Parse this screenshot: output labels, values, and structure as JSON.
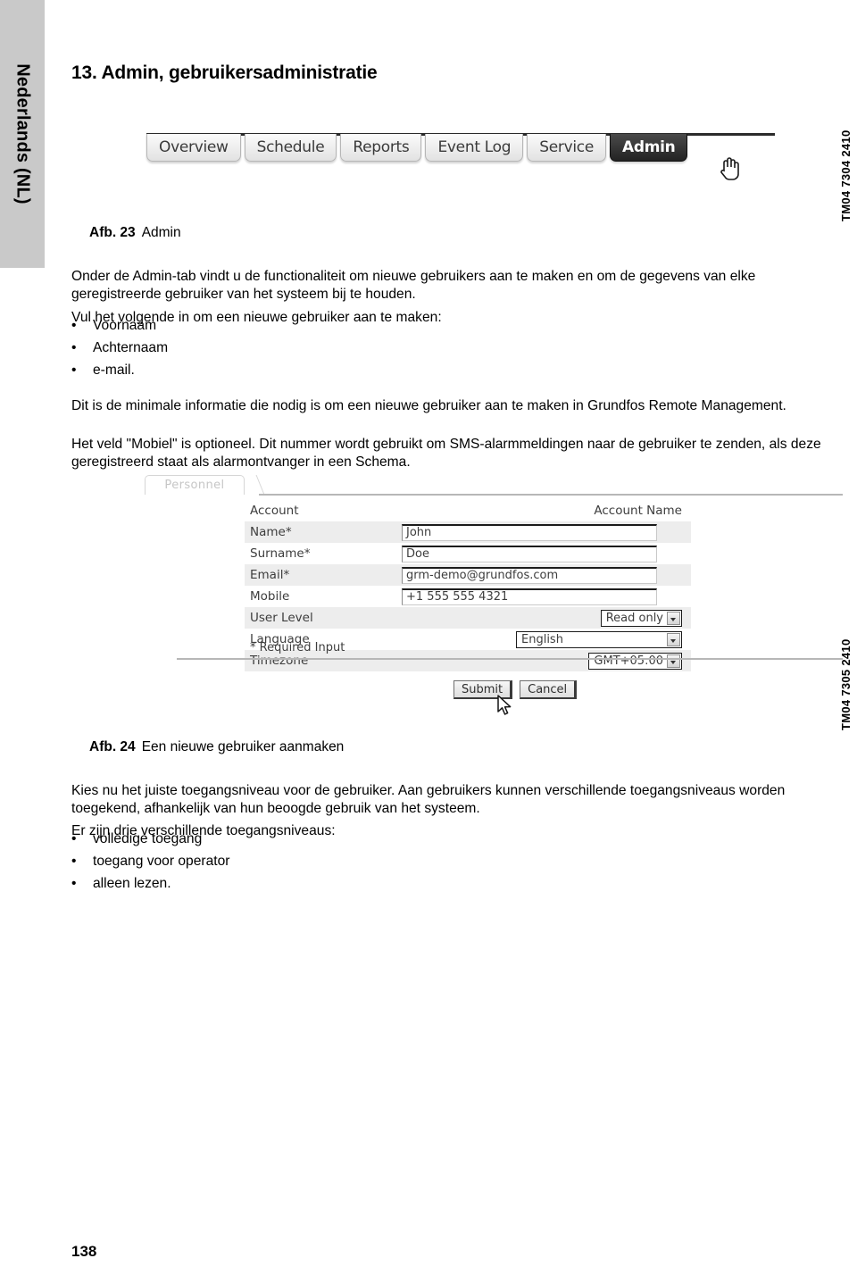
{
  "language_tab": {
    "label": "Nederlands (NL)"
  },
  "page": {
    "title": "13. Admin, gebruikersadministratie",
    "number": "138"
  },
  "nav_screenshot": {
    "tabs": [
      {
        "label": "Overview",
        "active": false
      },
      {
        "label": "Schedule",
        "active": false
      },
      {
        "label": "Reports",
        "active": false
      },
      {
        "label": "Event Log",
        "active": false
      },
      {
        "label": "Service",
        "active": false
      },
      {
        "label": "Admin",
        "active": true
      }
    ],
    "cursor": "hand-cursor-icon"
  },
  "figure_23": {
    "label": "Afb. 23",
    "text": "Admin",
    "code": "TM04 7304 2410"
  },
  "figure_24": {
    "label": "Afb. 24",
    "text": "Een nieuwe gebruiker aanmaken",
    "code": "TM04 7305 2410"
  },
  "body": {
    "para_1": "Onder de Admin-tab vindt u de functionaliteit om nieuwe gebruikers aan te maken en om de gegevens van elke geregistreerde gebruiker van het systeem bij te houden.",
    "para_2": "Vul het volgende in om een nieuwe gebruiker aan te maken:",
    "list_1": [
      "Voornaam",
      "Achternaam",
      "e-mail."
    ],
    "para_3": "Dit is de minimale informatie die nodig is om een nieuwe gebruiker aan te maken in Grundfos Remote Management.",
    "para_4": "Het veld \"Mobiel\" is optioneel. Dit nummer wordt gebruikt om SMS-alarmmeldingen naar de gebruiker te zenden, als deze geregistreerd staat als alarmontvanger in een Schema.",
    "para_5": "Kies nu het juiste toegangsniveau voor de gebruiker. Aan gebruikers kunnen verschillende toegangsniveaus worden toegekend, afhankelijk van hun beoogde gebruik van het systeem.",
    "para_6": "Er zijn drie verschillende toegangsniveaus:",
    "list_2": [
      "volledige toegang",
      "toegang voor operator",
      "alleen lezen."
    ],
    "bullet_char": "•"
  },
  "form_screenshot": {
    "panel_tab": "Personnel",
    "header": {
      "left": "Account",
      "right": "Account Name"
    },
    "fields": [
      {
        "label": "Name*",
        "value": "John",
        "type": "text",
        "shaded": true
      },
      {
        "label": "Surname*",
        "value": "Doe",
        "type": "text",
        "shaded": false
      },
      {
        "label": "Email*",
        "value": "grm-demo@grundfos.com",
        "type": "text",
        "shaded": true
      },
      {
        "label": "Mobile",
        "value": "+1 555 555 4321",
        "type": "text",
        "shaded": false
      },
      {
        "label": "User Level",
        "value": "Read only",
        "type": "select",
        "shaded": true
      },
      {
        "label": "Language",
        "value": "English",
        "type": "select",
        "shaded": false
      },
      {
        "label": "Timezone",
        "value": "GMT+05:00",
        "type": "select",
        "shaded": true
      }
    ],
    "required_note": "* Required Input",
    "buttons": {
      "submit": "Submit",
      "cancel": "Cancel"
    },
    "cursor": "arrow-cursor-icon"
  }
}
